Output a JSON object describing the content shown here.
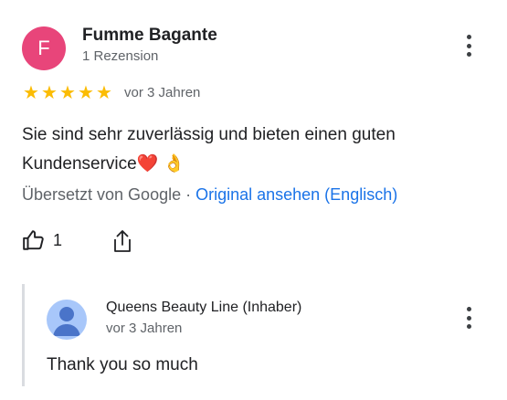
{
  "review": {
    "author_initial": "F",
    "author_name": "Fumme Bagante",
    "author_meta": "1 Rezension",
    "avatar_color": "#e8457a",
    "rating": 5,
    "stars": [
      "★",
      "★",
      "★",
      "★",
      "★"
    ],
    "time_ago": "vor 3 Jahren",
    "text": "Sie sind sehr zuverlässig und bieten einen guten Kundenservice❤️ 👌",
    "translated_prefix": "Übersetzt von Google · ",
    "translated_link": "Original ansehen (Englisch)",
    "like_count": "1"
  },
  "reply": {
    "name": "Queens Beauty Line (Inhaber)",
    "time_ago": "vor 3 Jahren",
    "text": "Thank you so much"
  },
  "colors": {
    "star": "#fbbc04",
    "link": "#1a73e8",
    "reply_avatar": "#a8c7fa"
  },
  "icons": {
    "like": "thumbs-up-icon",
    "share": "share-icon",
    "more": "more-vert-icon",
    "reply_avatar": "person-icon"
  }
}
